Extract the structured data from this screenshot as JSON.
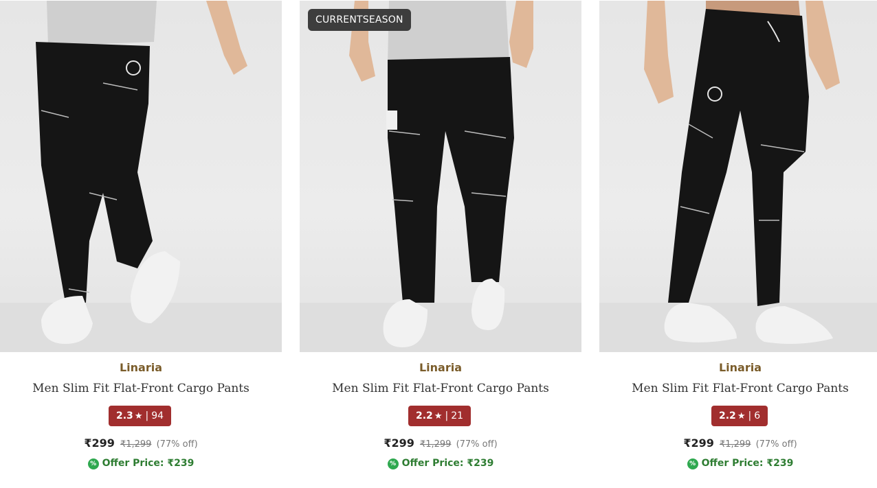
{
  "products": [
    {
      "badge": "",
      "brand": "Linaria",
      "title": "Men Slim Fit Flat-Front Cargo Pants",
      "rating": "2.3",
      "rating_count": "94",
      "price": "₹299",
      "mrp": "₹1,299",
      "discount": "(77% off)",
      "offer": "Offer Price: ₹239",
      "image_icon": "product-photo"
    },
    {
      "badge": "CURRENTSEASON",
      "brand": "Linaria",
      "title": "Men Slim Fit Flat-Front Cargo Pants",
      "rating": "2.2",
      "rating_count": "21",
      "price": "₹299",
      "mrp": "₹1,299",
      "discount": "(77% off)",
      "offer": "Offer Price: ₹239",
      "image_icon": "product-photo"
    },
    {
      "badge": "",
      "brand": "Linaria",
      "title": "Men Slim Fit Flat-Front Cargo Pants",
      "rating": "2.2",
      "rating_count": "6",
      "price": "₹299",
      "mrp": "₹1,299",
      "discount": "(77% off)",
      "offer": "Offer Price: ₹239",
      "image_icon": "product-photo"
    }
  ],
  "symbols": {
    "star": "★",
    "separator": "|",
    "offer_icon": "%"
  },
  "colors": {
    "brand": "#7a5c2a",
    "rating_bg": "#a12e2e",
    "offer_green": "#2e7d32",
    "badge_bg": "#3d3d3d"
  }
}
